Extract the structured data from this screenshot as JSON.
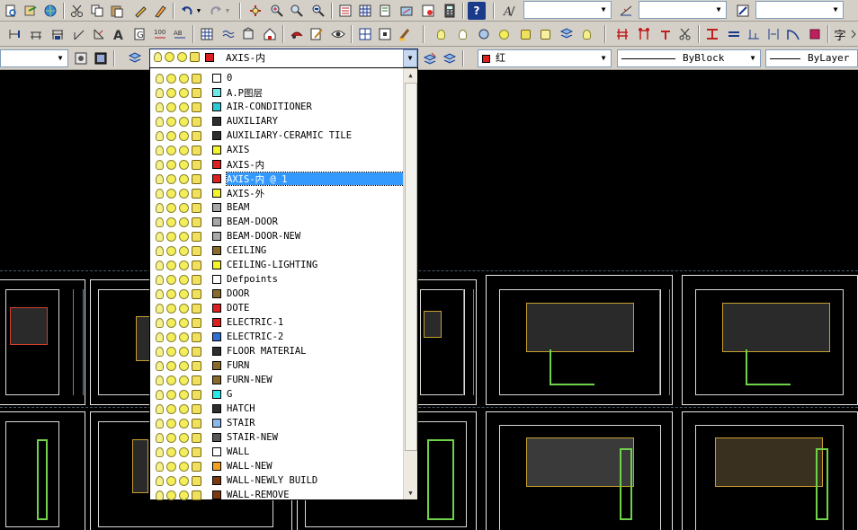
{
  "toolbar3": {
    "current_layer": "AXIS-内",
    "color_value": "红",
    "linetype_value": "ByBlock",
    "lineweight_value": "ByLayer",
    "current_layer_color": "#dd1f1f",
    "color_swatch": "#dd1f1f"
  },
  "toolbar2": {
    "chinese_glyph": "字"
  },
  "layer_list": {
    "layers": [
      {
        "name": "0",
        "color": "#ffffff"
      },
      {
        "name": "A.P图层",
        "color": "#6fe8e8"
      },
      {
        "name": "AIR-CONDITIONER",
        "color": "#29c9d8"
      },
      {
        "name": "AUXILIARY",
        "color": "#2e2e2e"
      },
      {
        "name": "AUXILIARY-CERAMIC TILE",
        "color": "#2e2e2e"
      },
      {
        "name": "AXIS",
        "color": "#f4f42a"
      },
      {
        "name": "AXIS-内",
        "color": "#dd1f1f"
      },
      {
        "name": "AXIS-内 @ 1",
        "color": "#dd1f1f",
        "selected": true
      },
      {
        "name": "AXIS-外",
        "color": "#f4f42a"
      },
      {
        "name": "BEAM",
        "color": "#a8a8a8"
      },
      {
        "name": "BEAM-DOOR",
        "color": "#a8a8a8"
      },
      {
        "name": "BEAM-DOOR-NEW",
        "color": "#a8a8a8"
      },
      {
        "name": "CEILING",
        "color": "#8a6a2a"
      },
      {
        "name": "CEILING-LIGHTING",
        "color": "#f4f42a"
      },
      {
        "name": "Defpoints",
        "color": "#ffffff"
      },
      {
        "name": "DOOR",
        "color": "#8a6a2a"
      },
      {
        "name": "DOTE",
        "color": "#dd1f1f"
      },
      {
        "name": "ELECTRIC-1",
        "color": "#dd1f1f"
      },
      {
        "name": "ELECTRIC-2",
        "color": "#2e6fd8"
      },
      {
        "name": "FLOOR MATERIAL",
        "color": "#2e2e2e"
      },
      {
        "name": "FURN",
        "color": "#8a6a2a"
      },
      {
        "name": "FURN-NEW",
        "color": "#8a6a2a"
      },
      {
        "name": "G",
        "color": "#29e8e8"
      },
      {
        "name": "HATCH",
        "color": "#2e2e2e"
      },
      {
        "name": "STAIR",
        "color": "#8ab8e8"
      },
      {
        "name": "STAIR-NEW",
        "color": "#585858"
      },
      {
        "name": "WALL",
        "color": "#ffffff"
      },
      {
        "name": "WALL-NEW",
        "color": "#f4a020"
      },
      {
        "name": "WALL-NEWLY BUILD",
        "color": "#7a3a10"
      },
      {
        "name": "WALL-REMOVE",
        "color": "#7a3a10"
      }
    ]
  }
}
